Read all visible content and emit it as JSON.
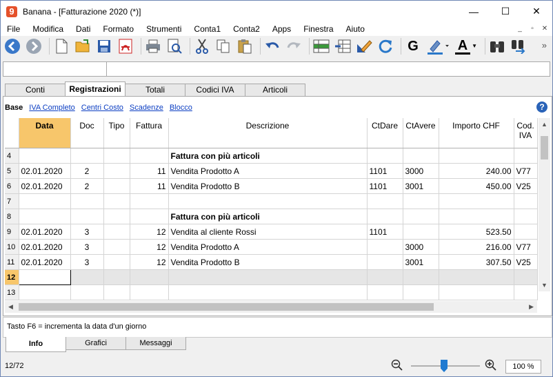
{
  "window": {
    "title": "Banana - [Fatturazione 2020 (*)]",
    "minimize": "—",
    "maximize": "☐",
    "close": "✕"
  },
  "menu": [
    "File",
    "Modifica",
    "Dati",
    "Formato",
    "Strumenti",
    "Conta1",
    "Conta2",
    "Apps",
    "Finestra",
    "Aiuto"
  ],
  "mdi_controls": [
    "_",
    "▫",
    "✕"
  ],
  "toolbar": {
    "icons": [
      "back-icon",
      "forward-icon",
      "new-file-icon",
      "open-folder-icon",
      "save-icon",
      "pdf-icon",
      "print-icon",
      "print-preview-icon",
      "cut-icon",
      "copy-icon",
      "paste-icon",
      "undo-icon",
      "redo-icon",
      "add-row-icon",
      "delete-row-icon",
      "edit-icon",
      "refresh-icon",
      "bold-icon",
      "highlight-icon",
      "font-color-icon",
      "find-icon",
      "find-replace-icon",
      "overflow-icon"
    ],
    "bold_label": "G",
    "font_color_label": "A",
    "overflow_label": "»"
  },
  "tabs": [
    {
      "label": "Conti",
      "active": false
    },
    {
      "label": "Registrazioni",
      "active": true
    },
    {
      "label": "Totali",
      "active": false
    },
    {
      "label": "Codici IVA",
      "active": false
    },
    {
      "label": "Articoli",
      "active": false
    }
  ],
  "views": {
    "current": "Base",
    "links": [
      "IVA Completo",
      "Centri Costo",
      "Scadenze",
      "Blocco"
    ]
  },
  "help_label": "?",
  "columns": [
    "Data",
    "Doc",
    "Tipo",
    "Fattura",
    "Descrizione",
    "CtDare",
    "CtAvere",
    "Importo CHF",
    "Cod. IVA"
  ],
  "rows": [
    {
      "n": "4",
      "data": "",
      "doc": "",
      "tipo": "",
      "fattura": "",
      "descrizione": "Fattura con più articoli",
      "ctdare": "",
      "ctavere": "",
      "importo": "",
      "codiva": "",
      "bold": true
    },
    {
      "n": "5",
      "data": "02.01.2020",
      "doc": "2",
      "tipo": "",
      "fattura": "11",
      "descrizione": "Vendita Prodotto A",
      "ctdare": "1101",
      "ctavere": "3000",
      "importo": "240.00",
      "codiva": "V77"
    },
    {
      "n": "6",
      "data": "02.01.2020",
      "doc": "2",
      "tipo": "",
      "fattura": "11",
      "descrizione": "Vendita Prodotto B",
      "ctdare": "1101",
      "ctavere": "3001",
      "importo": "450.00",
      "codiva": "V25"
    },
    {
      "n": "7",
      "data": "",
      "doc": "",
      "tipo": "",
      "fattura": "",
      "descrizione": "",
      "ctdare": "",
      "ctavere": "",
      "importo": "",
      "codiva": ""
    },
    {
      "n": "8",
      "data": "",
      "doc": "",
      "tipo": "",
      "fattura": "",
      "descrizione": "Fattura con più articoli",
      "ctdare": "",
      "ctavere": "",
      "importo": "",
      "codiva": "",
      "bold": true
    },
    {
      "n": "9",
      "data": "02.01.2020",
      "doc": "3",
      "tipo": "",
      "fattura": "12",
      "descrizione": "Vendita al cliente Rossi",
      "ctdare": "1101",
      "ctavere": "",
      "importo": "523.50",
      "codiva": ""
    },
    {
      "n": "10",
      "data": "02.01.2020",
      "doc": "3",
      "tipo": "",
      "fattura": "12",
      "descrizione": "Vendita Prodotto A",
      "ctdare": "",
      "ctavere": "3000",
      "importo": "216.00",
      "codiva": "V77"
    },
    {
      "n": "11",
      "data": "02.01.2020",
      "doc": "3",
      "tipo": "",
      "fattura": "12",
      "descrizione": "Vendita Prodotto B",
      "ctdare": "",
      "ctavere": "3001",
      "importo": "307.50",
      "codiva": "V25"
    },
    {
      "n": "12",
      "data": "",
      "doc": "",
      "tipo": "",
      "fattura": "",
      "descrizione": "",
      "ctdare": "",
      "ctavere": "",
      "importo": "",
      "codiva": "",
      "editing": true
    },
    {
      "n": "13",
      "data": "",
      "doc": "",
      "tipo": "",
      "fattura": "",
      "descrizione": "",
      "ctdare": "",
      "ctavere": "",
      "importo": "",
      "codiva": ""
    }
  ],
  "message": "Tasto F6 = incrementa la data d'un giorno",
  "bottom_tabs": [
    {
      "label": "Info",
      "active": true
    },
    {
      "label": "Grafici",
      "active": false
    },
    {
      "label": "Messaggi",
      "active": false
    }
  ],
  "status": {
    "position": "12/72",
    "zoom": "100 %",
    "zoom_level": 0.5
  },
  "colors": {
    "selected_header": "#f7c66b",
    "accent_blue": "#1f7ad1",
    "link": "#0a3dc2"
  }
}
